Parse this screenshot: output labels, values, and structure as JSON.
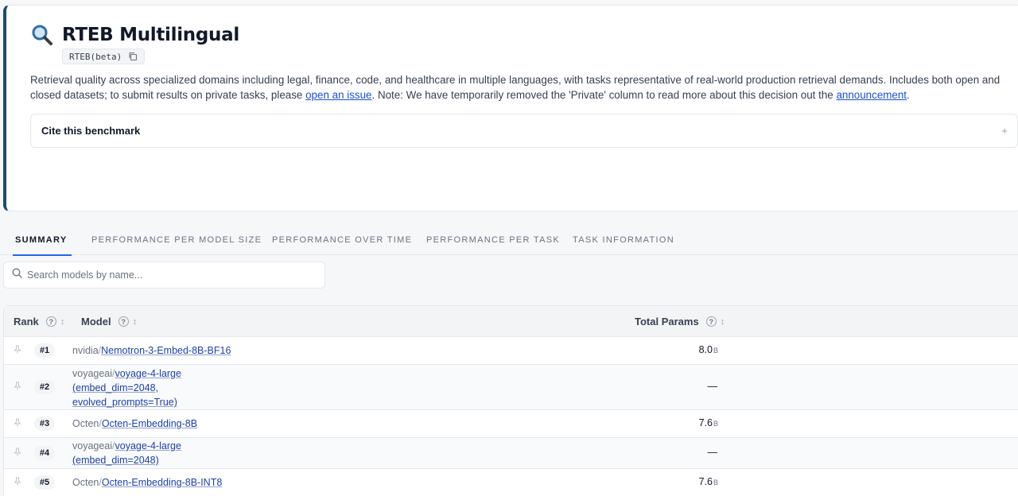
{
  "header": {
    "title": "RTEB Multilingual",
    "badge": "RTEB(beta)",
    "description": {
      "part1": "Retrieval quality across specialized domains including legal, finance, code, and healthcare in multiple languages, with tasks representative of real-world production retrieval demands. Includes both open and closed datasets; to submit results on private tasks, please ",
      "link1": "open an issue",
      "part2": ". Note: We have temporarily removed the 'Private' column to read more about this decision out the ",
      "link2": "announcement",
      "part3": "."
    },
    "cite_label": "Cite this benchmark",
    "cite_toggle": "+"
  },
  "tabs": [
    {
      "label": "SUMMARY",
      "active": true
    },
    {
      "label": "PERFORMANCE PER MODEL SIZE"
    },
    {
      "label": "PERFORMANCE OVER TIME"
    },
    {
      "label": "PERFORMANCE PER TASK"
    },
    {
      "label": "TASK INFORMATION"
    }
  ],
  "search": {
    "placeholder": "Search models by name..."
  },
  "table": {
    "columns": {
      "rank": "Rank",
      "model": "Model",
      "params": "Total Params",
      "help": "?",
      "sort": "↕"
    },
    "rows": [
      {
        "rank": "#1",
        "org": "nvidia",
        "sep": "/",
        "name": "Nemotron-3-Embed-8B-BF16",
        "params": "8.0",
        "unit": "B"
      },
      {
        "rank": "#2",
        "org": "voyageai",
        "sep": "/",
        "name": "voyage-4-large",
        "name2": "(embed_dim=2048,",
        "name3": "evolved_prompts=True)",
        "params": "—",
        "unit": ""
      },
      {
        "rank": "#3",
        "org": "Octen",
        "sep": "/",
        "name": "Octen-Embedding-8B",
        "params": "7.6",
        "unit": "B"
      },
      {
        "rank": "#4",
        "org": "voyageai",
        "sep": "/",
        "name": "voyage-4-large",
        "name2": "(embed_dim=2048)",
        "params": "—",
        "unit": ""
      },
      {
        "rank": "#5",
        "org": "Octen",
        "sep": "/",
        "name": "Octen-Embedding-8B-INT8",
        "params": "7.6",
        "unit": "B"
      }
    ]
  }
}
